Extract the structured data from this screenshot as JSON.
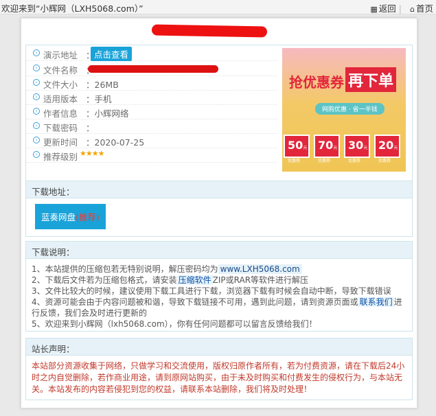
{
  "topbar": {
    "welcome": "欢迎来到“小辉网（LXH5068.com）”",
    "back_label": "返回",
    "home_label": "首页"
  },
  "info": {
    "rows": [
      {
        "label": "演示地址",
        "value": "："
      },
      {
        "label": "文件名称",
        "value": "："
      },
      {
        "label": "文件大小",
        "value": "：26MB"
      },
      {
        "label": "适用版本",
        "value": "：手机"
      },
      {
        "label": "作者信息",
        "value": "：小辉网络"
      },
      {
        "label": "下载密码",
        "value": "："
      },
      {
        "label": "更新时间",
        "value": "：2020-07-25"
      },
      {
        "label": "推荐级别",
        "value": "："
      }
    ],
    "demo_button": "点击查看",
    "stars": "★★★★"
  },
  "ad": {
    "title_part1": "抢优惠券",
    "title_part2": "再下单",
    "subtitle": "网购优惠 · 省一半钱",
    "coupons": [
      {
        "amount": "50",
        "unit": "元优惠券"
      },
      {
        "amount": "70",
        "unit": "元优惠券"
      },
      {
        "amount": "30",
        "unit": "元优惠券"
      },
      {
        "amount": "20",
        "unit": "元优惠券"
      }
    ]
  },
  "download": {
    "heading": "下载地址：",
    "button_label": "蓝奏网盘",
    "button_tag": "(推荐)"
  },
  "instructions": {
    "heading": "下载说明：",
    "line1_pre": "1、本站提供的压缩包若无特别说明，解压密码均为",
    "line1_hl": "www.LXH5068.com",
    "line2_pre": "2、下载后文件若为压缩包格式，请安装",
    "line2_hl": "压缩软件",
    "line2_post": "ZIP或RAR等软件进行解压",
    "line3": "3、文件比较大的时候，建议使用下载工具进行下载，浏览器下载有时候会自动中断，导致下载错误",
    "line4_pre": "4、资源可能会由于内容问题被和谐，导致下载链接不可用，遇到此问题，请到资源页面或",
    "line4_hl": "联系我们",
    "line4_post": "进行反馈，我们会及时进行更新的",
    "line5": "5、欢迎来到小辉网（lxh5068.com），你有任何问题都可以留言反馈给我们！"
  },
  "notice": {
    "heading": "站长声明：",
    "text": "本站部分资源收集于网络，只做学习和交流使用，版权归原作者所有，若为付费资源，请在下载后24小时之内自觉删除，若作商业用途，请到原网站购买，由于未及时购买和付费发生的侵权行为，与本站无关。本站发布的内容若侵犯到您的权益，请联系本站删除，我们将及时处理！"
  }
}
